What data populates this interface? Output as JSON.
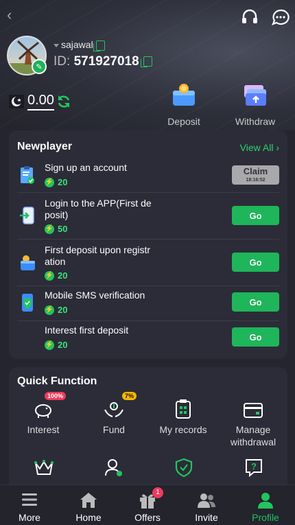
{
  "profile": {
    "username": "sajawal",
    "id_label": "ID:",
    "id_value": "571927018",
    "balance": "0.00"
  },
  "quick_actions": [
    {
      "label": "Deposit",
      "icon": "wallet-coin-icon"
    },
    {
      "label": "Withdraw",
      "icon": "cards-withdraw-icon"
    }
  ],
  "newplayer": {
    "title": "Newplayer",
    "view_all": "View All",
    "tasks": [
      {
        "title": "Sign up an account",
        "reward": "20",
        "action": "Claim",
        "timer": "18:16:52",
        "icon": "clipboard-check-icon"
      },
      {
        "title": "Login to the APP(First deposit)",
        "title_lines": [
          "Login to the APP(First de",
          "posit)"
        ],
        "reward": "50",
        "action": "Go",
        "icon": "phone-login-icon"
      },
      {
        "title": "First deposit upon registration",
        "title_lines": [
          "First deposit upon registr",
          "ation"
        ],
        "reward": "20",
        "action": "Go",
        "icon": "wallet-icon"
      },
      {
        "title": "Mobile SMS verification",
        "reward": "20",
        "action": "Go",
        "icon": "phone-shield-icon"
      },
      {
        "title": "Interest first deposit",
        "reward": "20",
        "action": "Go",
        "icon": "none"
      }
    ]
  },
  "quick_function": {
    "title": "Quick Function",
    "items": [
      {
        "label": "Interest",
        "tag": "100%",
        "tag_color": "#ef3b5c",
        "icon": "piggy-bank-icon"
      },
      {
        "label": "Fund",
        "tag": "7%",
        "tag_color": "#f5b700",
        "icon": "hands-coin-icon"
      },
      {
        "label": "My records",
        "icon": "records-icon"
      },
      {
        "label": "Manage withdrawal",
        "label_lines": [
          "Manage",
          "withdrawal"
        ],
        "icon": "card-manage-icon"
      }
    ],
    "second_row_icons": [
      "crown-icon",
      "user-icon",
      "shield-check-icon",
      "question-icon"
    ]
  },
  "nav": {
    "items": [
      {
        "label": "More",
        "icon": "menu-icon",
        "active": false
      },
      {
        "label": "Home",
        "icon": "home-icon",
        "active": false
      },
      {
        "label": "Offers",
        "icon": "gift-icon",
        "active": false,
        "badge": "1"
      },
      {
        "label": "Invite",
        "icon": "users-icon",
        "active": false
      },
      {
        "label": "Profile",
        "icon": "profile-icon",
        "active": true
      }
    ]
  },
  "colors": {
    "accent": "#1fb55a",
    "active_nav": "#22c55e",
    "badge": "#ef3b5c"
  }
}
